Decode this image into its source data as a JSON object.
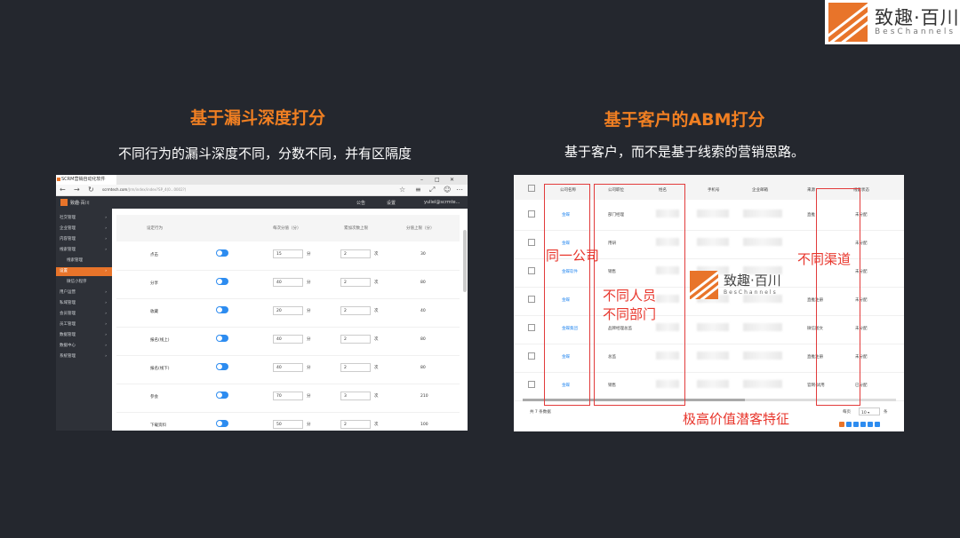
{
  "brand": {
    "name": "致趣·百川",
    "sub": "BesChannels"
  },
  "left": {
    "title": "基于漏斗深度打分",
    "subtitle": "不同行为的漏斗深度不同，分数不同，并有区隔度",
    "tab": "SCRM营销自动化软件",
    "url_domain": "scrmtech.com",
    "url_rest": "/Jrm/index/index?SP_4(0...0002?)",
    "header_right": [
      "公告",
      "设置",
      "yuliel@scrmte..."
    ],
    "sidebar": [
      {
        "label": "社交管理",
        "state": "normal"
      },
      {
        "label": "企业管理",
        "state": "normal"
      },
      {
        "label": "内容管理",
        "state": "normal"
      },
      {
        "label": "线索管理",
        "state": "normal"
      },
      {
        "label": "线索管理",
        "state": "sub"
      },
      {
        "label": "设置",
        "state": "active"
      },
      {
        "label": "微信小程序",
        "state": "sub"
      },
      {
        "label": "用户运营",
        "state": "normal"
      },
      {
        "label": "私域管理",
        "state": "normal"
      },
      {
        "label": "会员管理",
        "state": "normal"
      },
      {
        "label": "员工管理",
        "state": "normal"
      },
      {
        "label": "数据管理",
        "state": "normal"
      },
      {
        "label": "数据中心",
        "state": "normal"
      },
      {
        "label": "系统管理",
        "state": "normal"
      }
    ],
    "table_headers": [
      "设定行为",
      "每次分值（分）",
      "累加次数上限",
      "分值上限（分）"
    ],
    "rows": [
      {
        "name": "点击",
        "score": "15",
        "limit": "2",
        "cap": "30"
      },
      {
        "name": "分享",
        "score": "40",
        "limit": "2",
        "cap": "80"
      },
      {
        "name": "收藏",
        "score": "20",
        "limit": "2",
        "cap": "40"
      },
      {
        "name": "报名(线上)",
        "score": "40",
        "limit": "2",
        "cap": "80"
      },
      {
        "name": "报名(线下)",
        "score": "40",
        "limit": "2",
        "cap": "80"
      },
      {
        "name": "参会",
        "score": "70",
        "limit": "3",
        "cap": "210"
      },
      {
        "name": "下载资料",
        "score": "50",
        "limit": "2",
        "cap": "100"
      }
    ],
    "unit_score": "分",
    "unit_times": "次"
  },
  "right": {
    "title": "基于客户的ABM打分",
    "subtitle": "基于客户，而不是基于线索的营销思路。",
    "headers": [
      "公司名称",
      "公司职位",
      "姓名",
      "手机号",
      "企业邮箱",
      "来源",
      "线索状态"
    ],
    "rows": [
      {
        "company": "金蝶",
        "position": "部门经理",
        "source": "直推",
        "status": "未分配"
      },
      {
        "company": "金蝶",
        "position": "用研",
        "source": "",
        "status": "未分配"
      },
      {
        "company": "金蝶软件",
        "position": "销售",
        "source": "",
        "status": "未分配"
      },
      {
        "company": "金蝶",
        "position": "",
        "source": "直推注册",
        "status": "未分配"
      },
      {
        "company": "金蝶集团",
        "position": "品牌经理总监",
        "source": "微信图文",
        "status": "未分配"
      },
      {
        "company": "金蝶",
        "position": "总监",
        "source": "直推注册",
        "status": "未分配"
      },
      {
        "company": "金蝶",
        "position": "销售",
        "source": "官网-试用",
        "status": "已分配"
      }
    ],
    "label_company": "同一公司",
    "label_people_1": "不同人员",
    "label_people_2": "不同部门",
    "label_channel": "不同渠道",
    "feature": "极高价值潜客特征",
    "total": "共 7 条数据",
    "per_page_label": "每页",
    "per_page": "10",
    "per_page_suffix": "条"
  }
}
